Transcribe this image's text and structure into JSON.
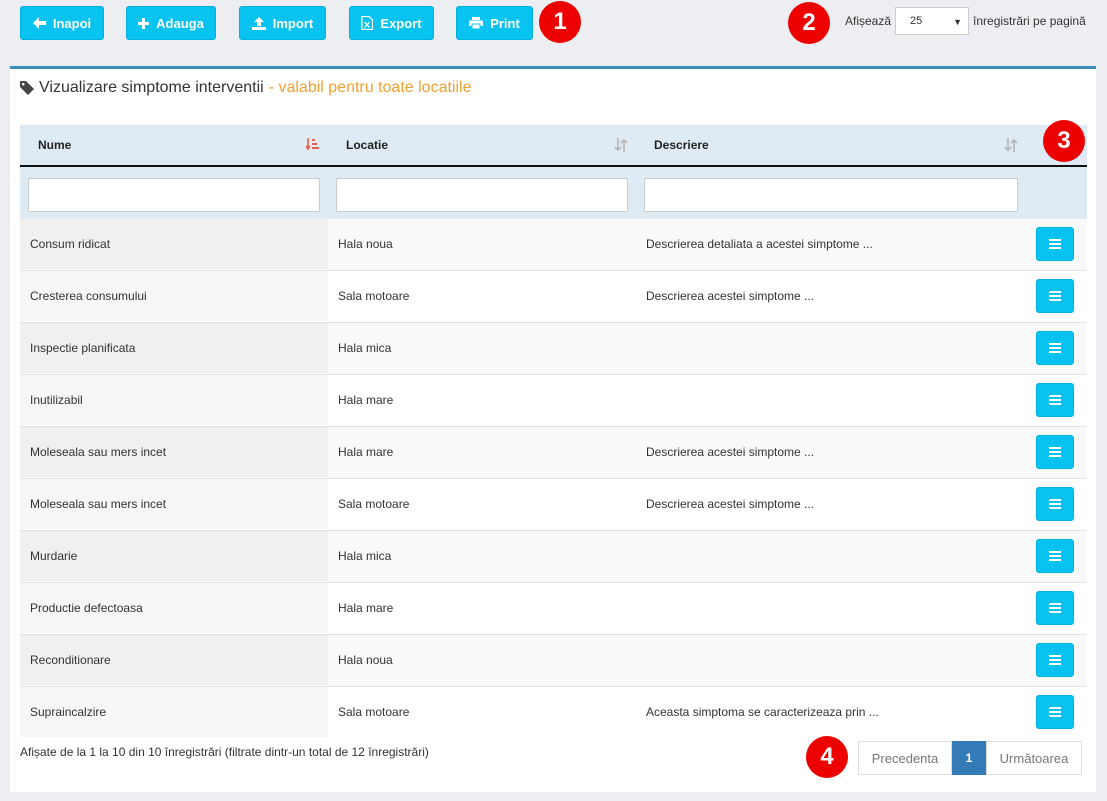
{
  "toolbar": {
    "back_label": "Inapoi",
    "add_label": "Adauga",
    "import_label": "Import",
    "export_label": "Export",
    "print_label": "Print"
  },
  "badges": [
    "1",
    "2",
    "3",
    "4"
  ],
  "page_size": {
    "prefix": "Afișează",
    "value": "25",
    "suffix": "înregistrări pe pagină"
  },
  "panel": {
    "title": "Vizualizare simptome interventii",
    "subtitle": "- valabil pentru toate locatiile"
  },
  "table": {
    "columns": [
      "Nume",
      "Locatie",
      "Descriere"
    ],
    "rows": [
      {
        "nume": "Consum ridicat",
        "locatie": "Hala noua",
        "descriere": "Descrierea detaliata a acestei simptome ..."
      },
      {
        "nume": "Cresterea consumului",
        "locatie": "Sala motoare",
        "descriere": "Descrierea acestei simptome ..."
      },
      {
        "nume": "Inspectie planificata",
        "locatie": "Hala mica",
        "descriere": ""
      },
      {
        "nume": "Inutilizabil",
        "locatie": "Hala mare",
        "descriere": ""
      },
      {
        "nume": "Moleseala sau mers incet",
        "locatie": "Hala mare",
        "descriere": "Descrierea acestei simptome ..."
      },
      {
        "nume": "Moleseala sau mers incet",
        "locatie": "Sala motoare",
        "descriere": "Descrierea acestei simptome ..."
      },
      {
        "nume": "Murdarie",
        "locatie": "Hala mica",
        "descriere": ""
      },
      {
        "nume": "Productie defectoasa",
        "locatie": "Hala mare",
        "descriere": ""
      },
      {
        "nume": "Reconditionare",
        "locatie": "Hala noua",
        "descriere": ""
      },
      {
        "nume": "Supraincalzire",
        "locatie": "Sala motoare",
        "descriere": "Aceasta simptoma se caracterizeaza prin ..."
      }
    ]
  },
  "info_text": "Afișate de la 1 la 10 din 10 înregistrări (filtrate dintr-un total de 12 înregistrări)",
  "pagination": {
    "prev": "Precedenta",
    "current": "1",
    "next": "Următoarea"
  },
  "colors": {
    "accent": "#08c3ef",
    "badge": "#ec0000",
    "subtitle": "#f0a030",
    "active_page": "#337ab7"
  }
}
